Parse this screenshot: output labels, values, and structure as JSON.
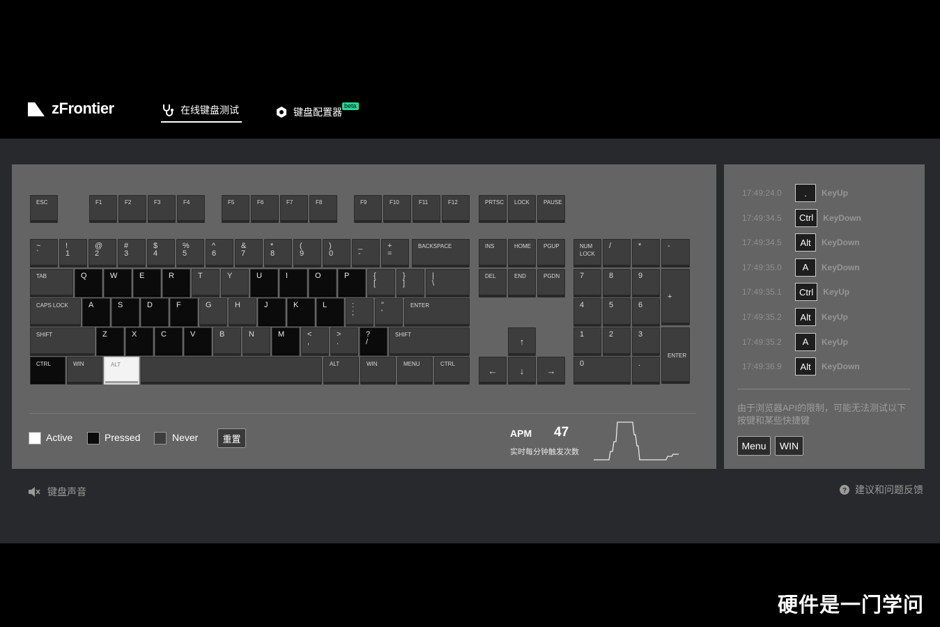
{
  "header": {
    "brand": "zFrontier",
    "tabs": [
      {
        "label": "在线键盘测试",
        "active": true
      },
      {
        "label": "键盘配置器",
        "badge": "beta"
      }
    ]
  },
  "keyboard": {
    "keys": [
      {
        "id": "esc",
        "label": "ESC",
        "state": "never"
      },
      {
        "id": "f1",
        "label": "F1",
        "state": "never"
      },
      {
        "id": "f2",
        "label": "F2",
        "state": "never"
      },
      {
        "id": "f3",
        "label": "F3",
        "state": "never"
      },
      {
        "id": "f4",
        "label": "F4",
        "state": "never"
      },
      {
        "id": "f5",
        "label": "F5",
        "state": "never"
      },
      {
        "id": "f6",
        "label": "F6",
        "state": "never"
      },
      {
        "id": "f7",
        "label": "F7",
        "state": "never"
      },
      {
        "id": "f8",
        "label": "F8",
        "state": "never"
      },
      {
        "id": "f9",
        "label": "F9",
        "state": "never"
      },
      {
        "id": "f10",
        "label": "F10",
        "state": "never"
      },
      {
        "id": "f11",
        "label": "F11",
        "state": "never"
      },
      {
        "id": "f12",
        "label": "F12",
        "state": "never"
      },
      {
        "id": "prtsc",
        "label": "PRTSC",
        "state": "never"
      },
      {
        "id": "lock",
        "label": "LOCK",
        "state": "never"
      },
      {
        "id": "pause",
        "label": "PAUSE",
        "state": "never"
      },
      {
        "id": "backtick",
        "label": "~\n`",
        "state": "never"
      },
      {
        "id": "d1",
        "label": "!\n1",
        "state": "never"
      },
      {
        "id": "d2",
        "label": "@\n2",
        "state": "never"
      },
      {
        "id": "d3",
        "label": "#\n3",
        "state": "never"
      },
      {
        "id": "d4",
        "label": "$\n4",
        "state": "never"
      },
      {
        "id": "d5",
        "label": "%\n5",
        "state": "never"
      },
      {
        "id": "d6",
        "label": "^\n6",
        "state": "never"
      },
      {
        "id": "d7",
        "label": "&\n7",
        "state": "never"
      },
      {
        "id": "d8",
        "label": "*\n8",
        "state": "never"
      },
      {
        "id": "d9",
        "label": "(\n9",
        "state": "never"
      },
      {
        "id": "d0",
        "label": ")\n0",
        "state": "never"
      },
      {
        "id": "minus",
        "label": "_\n-",
        "state": "never"
      },
      {
        "id": "equal",
        "label": "+\n=",
        "state": "never"
      },
      {
        "id": "backspace",
        "label": "BACKSPACE",
        "state": "never"
      },
      {
        "id": "ins",
        "label": "INS",
        "state": "never"
      },
      {
        "id": "home",
        "label": "HOME",
        "state": "never"
      },
      {
        "id": "pgup",
        "label": "PGUP",
        "state": "never"
      },
      {
        "id": "numlock",
        "label": "NUM\nLOCK",
        "state": "never"
      },
      {
        "id": "numdiv",
        "label": "/",
        "state": "never"
      },
      {
        "id": "nummul",
        "label": "*",
        "state": "never"
      },
      {
        "id": "numsub",
        "label": "-",
        "state": "never"
      },
      {
        "id": "tab",
        "label": "TAB",
        "state": "never"
      },
      {
        "id": "q",
        "label": "Q",
        "state": "pressed"
      },
      {
        "id": "w",
        "label": "W",
        "state": "pressed"
      },
      {
        "id": "e",
        "label": "E",
        "state": "pressed"
      },
      {
        "id": "r",
        "label": "R",
        "state": "pressed"
      },
      {
        "id": "t",
        "label": "T",
        "state": "never"
      },
      {
        "id": "y",
        "label": "Y",
        "state": "never"
      },
      {
        "id": "u",
        "label": "U",
        "state": "pressed"
      },
      {
        "id": "i",
        "label": "I",
        "state": "pressed"
      },
      {
        "id": "o",
        "label": "O",
        "state": "pressed"
      },
      {
        "id": "p",
        "label": "P",
        "state": "pressed"
      },
      {
        "id": "lbracket",
        "label": "{\n[",
        "state": "never"
      },
      {
        "id": "rbracket",
        "label": "}\n]",
        "state": "never"
      },
      {
        "id": "backslash",
        "label": "|\n\\",
        "state": "never"
      },
      {
        "id": "del",
        "label": "DEL",
        "state": "never"
      },
      {
        "id": "end",
        "label": "END",
        "state": "never"
      },
      {
        "id": "pgdn",
        "label": "PGDN",
        "state": "never"
      },
      {
        "id": "num7",
        "label": "7",
        "state": "never"
      },
      {
        "id": "num8",
        "label": "8",
        "state": "never"
      },
      {
        "id": "num9",
        "label": "9",
        "state": "never"
      },
      {
        "id": "numadd",
        "label": "+",
        "state": "never"
      },
      {
        "id": "caps",
        "label": "CAPS LOCK",
        "state": "never"
      },
      {
        "id": "a",
        "label": "A",
        "state": "pressed"
      },
      {
        "id": "s",
        "label": "S",
        "state": "pressed"
      },
      {
        "id": "d",
        "label": "D",
        "state": "pressed"
      },
      {
        "id": "f",
        "label": "F",
        "state": "pressed"
      },
      {
        "id": "g",
        "label": "G",
        "state": "never"
      },
      {
        "id": "h",
        "label": "H",
        "state": "never"
      },
      {
        "id": "j",
        "label": "J",
        "state": "pressed"
      },
      {
        "id": "k",
        "label": "K",
        "state": "pressed"
      },
      {
        "id": "l",
        "label": "L",
        "state": "pressed"
      },
      {
        "id": "semicolon",
        "label": ":\n;",
        "state": "never"
      },
      {
        "id": "quote",
        "label": "\"\n'",
        "state": "never"
      },
      {
        "id": "enter",
        "label": "ENTER",
        "state": "never"
      },
      {
        "id": "num4",
        "label": "4",
        "state": "never"
      },
      {
        "id": "num5",
        "label": "5",
        "state": "never"
      },
      {
        "id": "num6",
        "label": "6",
        "state": "never"
      },
      {
        "id": "lshift",
        "label": "SHIFT",
        "state": "never"
      },
      {
        "id": "z",
        "label": "Z",
        "state": "pressed"
      },
      {
        "id": "x",
        "label": "X",
        "state": "pressed"
      },
      {
        "id": "c",
        "label": "C",
        "state": "pressed"
      },
      {
        "id": "v",
        "label": "V",
        "state": "pressed"
      },
      {
        "id": "b",
        "label": "B",
        "state": "never"
      },
      {
        "id": "n",
        "label": "N",
        "state": "never"
      },
      {
        "id": "m",
        "label": "M",
        "state": "pressed"
      },
      {
        "id": "comma",
        "label": "<\n,",
        "state": "never"
      },
      {
        "id": "period",
        "label": ">\n.",
        "state": "never"
      },
      {
        "id": "slash",
        "label": "?\n/",
        "state": "pressed"
      },
      {
        "id": "rshift",
        "label": "SHIFT",
        "state": "never"
      },
      {
        "id": "up",
        "label": "↑",
        "state": "never"
      },
      {
        "id": "num1",
        "label": "1",
        "state": "never"
      },
      {
        "id": "num2",
        "label": "2",
        "state": "never"
      },
      {
        "id": "num3",
        "label": "3",
        "state": "never"
      },
      {
        "id": "numenter",
        "label": "ENTER",
        "state": "never"
      },
      {
        "id": "lctrl",
        "label": "CTRL",
        "state": "pressed"
      },
      {
        "id": "lwin",
        "label": "WIN",
        "state": "never"
      },
      {
        "id": "lalt",
        "label": "ALT",
        "state": "active"
      },
      {
        "id": "space",
        "label": "",
        "state": "never"
      },
      {
        "id": "ralt",
        "label": "ALT",
        "state": "never"
      },
      {
        "id": "rwin",
        "label": "WIN",
        "state": "never"
      },
      {
        "id": "menu",
        "label": "MENU",
        "state": "never"
      },
      {
        "id": "rctrl",
        "label": "CTRL",
        "state": "never"
      },
      {
        "id": "left",
        "label": "←",
        "state": "never"
      },
      {
        "id": "down",
        "label": "↓",
        "state": "never"
      },
      {
        "id": "right",
        "label": "→",
        "state": "never"
      },
      {
        "id": "num0",
        "label": "0",
        "state": "never"
      },
      {
        "id": "numdot",
        "label": ".",
        "state": "never"
      }
    ]
  },
  "legend": {
    "active": "Active",
    "pressed": "Pressed",
    "never": "Never",
    "reset": "重置"
  },
  "apm": {
    "label": "APM",
    "value": "47",
    "subtitle": "实时每分钟触发次数"
  },
  "log": {
    "entries": [
      {
        "time": "17:49:24.0",
        "key": ".",
        "event": "KeyUp"
      },
      {
        "time": "17:49:34.5",
        "key": "Ctrl",
        "event": "KeyDown"
      },
      {
        "time": "17:49:34.5",
        "key": "Alt",
        "event": "KeyDown"
      },
      {
        "time": "17:49:35.0",
        "key": "A",
        "event": "KeyDown"
      },
      {
        "time": "17:49:35.1",
        "key": "Ctrl",
        "event": "KeyUp"
      },
      {
        "time": "17:49:35.2",
        "key": "Alt",
        "event": "KeyUp"
      },
      {
        "time": "17:49:35.2",
        "key": "A",
        "event": "KeyUp"
      },
      {
        "time": "17:49:36.9",
        "key": "Alt",
        "event": "KeyDown"
      }
    ],
    "note": "由于浏览器API的限制，可能无法测试以下按键和某些快捷键",
    "buttons": [
      "Menu",
      "WIN"
    ]
  },
  "footer": {
    "sound": "键盘声音",
    "feedback": "建议和问题反馈"
  },
  "watermark": "硬件是一门学问",
  "colors": {
    "never": "#3d3d3d",
    "pressed": "#0b0b0b",
    "active": "#f3f3f3",
    "panel": "#646464",
    "beta": "#28d79a"
  }
}
